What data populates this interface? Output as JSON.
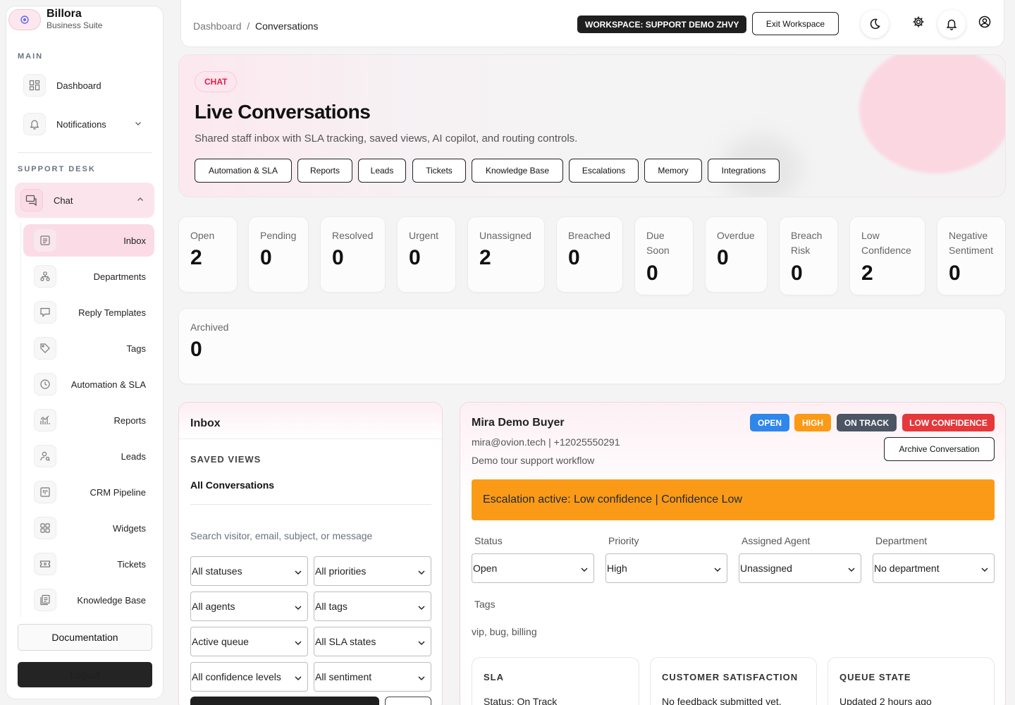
{
  "brand": {
    "name": "Billora",
    "subtitle": "Business Suite"
  },
  "sidebar": {
    "main_label": "MAIN",
    "dashboard": "Dashboard",
    "notifications": "Notifications",
    "support_label": "SUPPORT DESK",
    "chat": "Chat",
    "items": [
      {
        "label": "Inbox",
        "icon": "inbox-icon"
      },
      {
        "label": "Departments",
        "icon": "departments-icon"
      },
      {
        "label": "Reply Templates",
        "icon": "reply-templates-icon"
      },
      {
        "label": "Tags",
        "icon": "tag-icon"
      },
      {
        "label": "Automation & SLA",
        "icon": "clock-icon"
      },
      {
        "label": "Reports",
        "icon": "reports-icon"
      },
      {
        "label": "Leads",
        "icon": "leads-icon"
      },
      {
        "label": "CRM Pipeline",
        "icon": "pipeline-icon"
      },
      {
        "label": "Widgets",
        "icon": "widgets-icon"
      },
      {
        "label": "Tickets",
        "icon": "ticket-icon"
      },
      {
        "label": "Knowledge Base",
        "icon": "knowledge-base-icon"
      }
    ],
    "documentation": "Documentation",
    "logout": "Logout"
  },
  "topbar": {
    "breadcrumb_root": "Dashboard",
    "breadcrumb_sep": "/",
    "breadcrumb_current": "Conversations",
    "workspace_badge": "WORKSPACE: SUPPORT DEMO ZHVY",
    "exit_workspace": "Exit Workspace"
  },
  "hero": {
    "chip": "CHAT",
    "title": "Live Conversations",
    "subtitle": "Shared staff inbox with SLA tracking, saved views, AI copilot, and routing controls.",
    "pills": [
      "Automation & SLA",
      "Reports",
      "Leads",
      "Tickets",
      "Knowledge Base",
      "Escalations",
      "Memory",
      "Integrations"
    ]
  },
  "stats": [
    {
      "label": "Open",
      "value": "2"
    },
    {
      "label": "Pending",
      "value": "0"
    },
    {
      "label": "Resolved",
      "value": "0"
    },
    {
      "label": "Urgent",
      "value": "0"
    },
    {
      "label": "Unassigned",
      "value": "2"
    },
    {
      "label": "Breached",
      "value": "0"
    },
    {
      "label": "Due Soon",
      "value": "0"
    },
    {
      "label": "Overdue",
      "value": "0"
    },
    {
      "label": "Breach Risk",
      "value": "0"
    },
    {
      "label": "Low Confidence",
      "value": "2"
    },
    {
      "label": "Negative Sentiment",
      "value": "0"
    },
    {
      "label": "Archived",
      "value": "0"
    }
  ],
  "inbox": {
    "title": "Inbox",
    "saved_views_label": "SAVED VIEWS",
    "saved_view": "All Conversations",
    "search_placeholder": "Search visitor, email, subject, or message",
    "filters": [
      "All statuses",
      "All priorities",
      "All agents",
      "All tags",
      "Active queue",
      "All SLA states",
      "All confidence levels",
      "All sentiment"
    ]
  },
  "conversation": {
    "name": "Mira Demo Buyer",
    "meta": "mira@ovion.tech | +12025550291",
    "description": "Demo tour support workflow",
    "badges": [
      {
        "label": "OPEN",
        "color": "#2f86eb"
      },
      {
        "label": "HIGH",
        "color": "#fb9a16"
      },
      {
        "label": "ON TRACK",
        "color": "#4b5563"
      },
      {
        "label": "LOW CONFIDENCE",
        "color": "#e5383b"
      }
    ],
    "archive": "Archive Conversation",
    "escalation": "Escalation active: Low confidence | Confidence Low",
    "fields": [
      {
        "label": "Status",
        "value": "Open"
      },
      {
        "label": "Priority",
        "value": "High"
      },
      {
        "label": "Assigned Agent",
        "value": "Unassigned"
      },
      {
        "label": "Department",
        "value": "No department"
      }
    ],
    "tags_label": "Tags",
    "tags_value": "vip, bug, billing",
    "cards": [
      {
        "title": "SLA",
        "value": "Status: On Track"
      },
      {
        "title": "CUSTOMER SATISFACTION",
        "value": "No feedback submitted yet."
      },
      {
        "title": "QUEUE STATE",
        "value": "Updated 2 hours ago"
      }
    ]
  }
}
